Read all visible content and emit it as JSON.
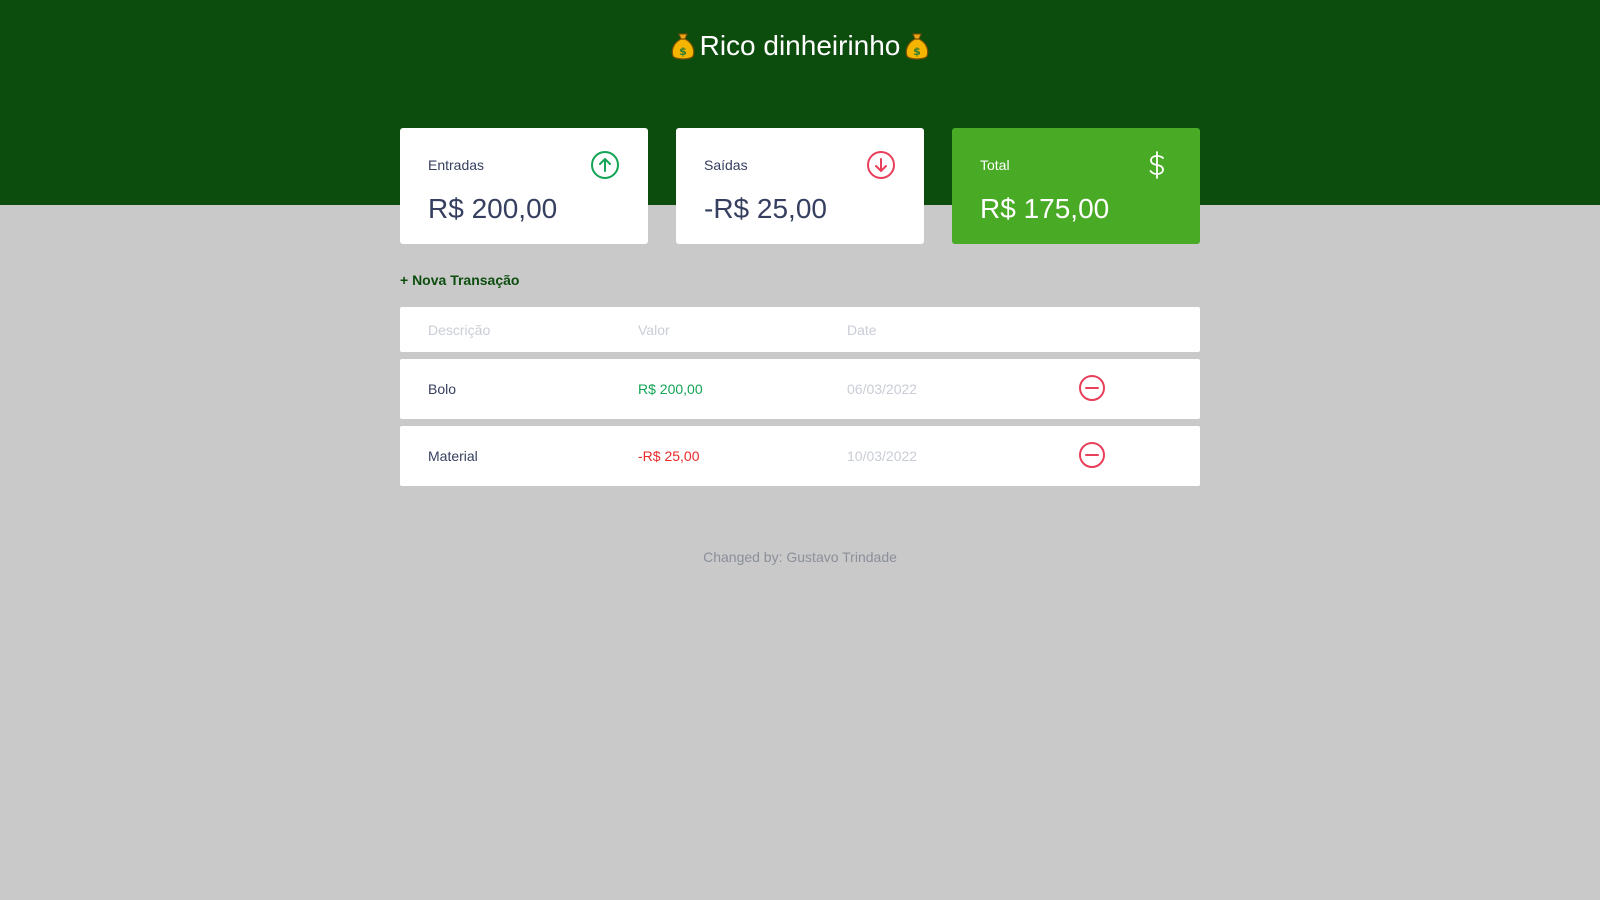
{
  "header": {
    "title": "Rico dinheirinho",
    "icon": "money-bag-icon"
  },
  "colors": {
    "header_bg": "#0c4d0e",
    "total_card": "#49aa26",
    "income": "#12a454",
    "expense": "#e92929",
    "page_bg": "#c9c9c9"
  },
  "cards": {
    "income": {
      "label": "Entradas",
      "value": "R$ 200,00",
      "icon": "arrow-up-circle-icon"
    },
    "expense": {
      "label": "Saídas",
      "value": "-R$ 25,00",
      "icon": "arrow-down-circle-icon"
    },
    "total": {
      "label": "Total",
      "value": "R$ 175,00",
      "icon": "dollar-sign-icon"
    }
  },
  "new_transaction_label": "+ Nova Transação",
  "table": {
    "headers": [
      "Descrição",
      "Valor",
      "Date"
    ],
    "rows": [
      {
        "description": "Bolo",
        "amount": "R$ 200,00",
        "type": "income",
        "date": "06/03/2022"
      },
      {
        "description": "Material",
        "amount": "-R$ 25,00",
        "type": "expense",
        "date": "10/03/2022"
      }
    ]
  },
  "footer": "Changed by: Gustavo Trindade"
}
